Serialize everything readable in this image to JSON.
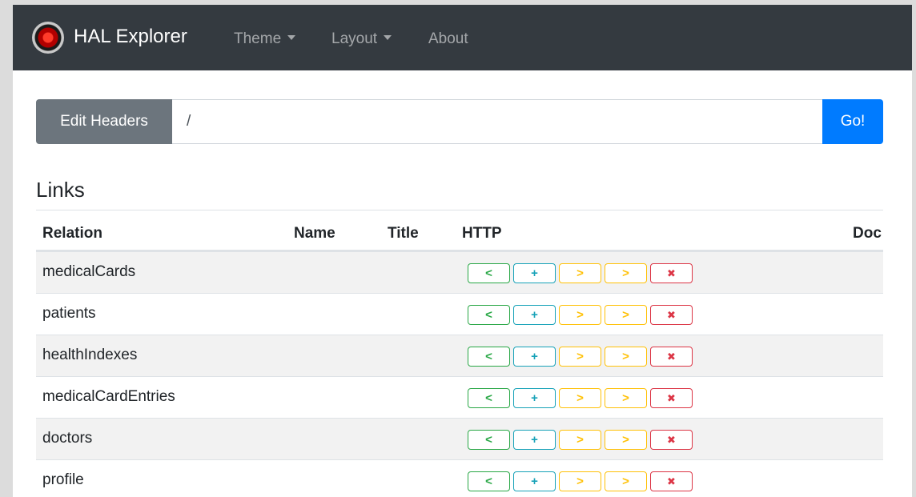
{
  "navbar": {
    "brand": "HAL Explorer",
    "items": [
      {
        "label": "Theme",
        "dropdown": true
      },
      {
        "label": "Layout",
        "dropdown": true
      },
      {
        "label": "About",
        "dropdown": false
      }
    ]
  },
  "request": {
    "edit_headers_label": "Edit Headers",
    "uri_value": "/",
    "go_label": "Go!"
  },
  "links": {
    "title": "Links",
    "columns": [
      "Relation",
      "Name",
      "Title",
      "HTTP",
      "Doc"
    ],
    "rows": [
      {
        "relation": "medicalCards",
        "name": "",
        "title": ""
      },
      {
        "relation": "patients",
        "name": "",
        "title": ""
      },
      {
        "relation": "healthIndexes",
        "name": "",
        "title": ""
      },
      {
        "relation": "medicalCardEntries",
        "name": "",
        "title": ""
      },
      {
        "relation": "doctors",
        "name": "",
        "title": ""
      },
      {
        "relation": "profile",
        "name": "",
        "title": ""
      }
    ],
    "http_buttons": [
      {
        "name": "get",
        "icon": "chevron-left-icon",
        "glyph": "<",
        "color": "#28a745"
      },
      {
        "name": "post",
        "icon": "plus-icon",
        "glyph": "+",
        "color": "#17a2b8"
      },
      {
        "name": "put",
        "icon": "chevron-right-icon",
        "glyph": ">",
        "color": "#ffc107"
      },
      {
        "name": "patch",
        "icon": "chevron-right-icon",
        "glyph": ">",
        "color": "#ffc107"
      },
      {
        "name": "delete",
        "icon": "x-icon",
        "glyph": "✖",
        "color": "#dc3545"
      }
    ]
  },
  "colors": {
    "navbar": "#343a40",
    "secondary": "#6c757d",
    "primary": "#007bff"
  }
}
